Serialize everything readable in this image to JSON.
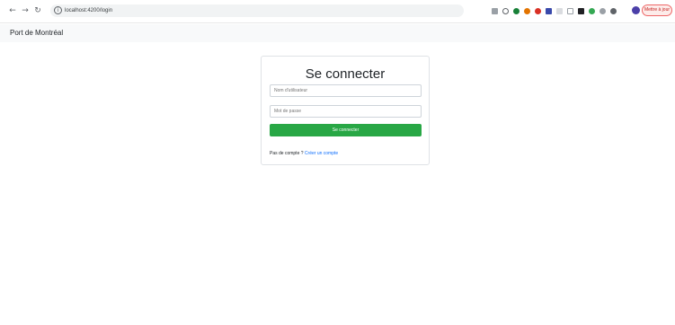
{
  "browser": {
    "url": "localhost:4200/login",
    "update_label": "Mettre à jour"
  },
  "navbar": {
    "brand": "Port de Montréal"
  },
  "login": {
    "title": "Se connecter",
    "username_placeholder": "Nom d'utilisateur",
    "password_placeholder": "Mot de passe",
    "submit_label": "Se connecter",
    "no_account_text": "Pas de compte ?",
    "create_account_link": "Créer un compte"
  },
  "colors": {
    "primary_button": "#28a745",
    "link": "#0d6efd",
    "navbar_bg": "#f8f9fa"
  },
  "icons": [
    "back-icon",
    "forward-icon",
    "reload-icon",
    "site-info-icon",
    "translate-icon",
    "bookmark-star-icon",
    "extension-icons",
    "profile-avatar-icon"
  ]
}
